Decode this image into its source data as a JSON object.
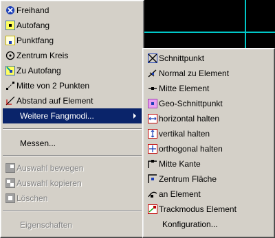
{
  "colors": {
    "menu_bg": "#d4d0c8",
    "highlight": "#0a246a",
    "disabled_text": "#808080",
    "canvas_bg": "#000000",
    "canvas_line": "#00c8c8"
  },
  "main_menu": {
    "items": [
      {
        "label": "Freihand",
        "icon": "freehand-icon"
      },
      {
        "label": "Autofang",
        "icon": "autosnap-icon"
      },
      {
        "label": "Punktfang",
        "icon": "point-snap-icon"
      },
      {
        "label": "Zentrum Kreis",
        "icon": "circle-center-icon"
      },
      {
        "label": "Zu Autofang",
        "icon": "to-autosnap-icon"
      },
      {
        "label": "Mitte von 2 Punkten",
        "icon": "midpoint-two-points-icon"
      },
      {
        "label": "Abstand auf Element",
        "icon": "distance-on-element-icon"
      },
      {
        "label": "Weitere Fangmodi...",
        "highlighted": true,
        "has_submenu": true
      },
      {
        "label": "Messen..."
      },
      {
        "label": "Auswahl bewegen",
        "icon": "move-selection-icon",
        "disabled": true
      },
      {
        "label": "Auswahl kopieren",
        "icon": "copy-selection-icon",
        "disabled": true
      },
      {
        "label": "Löschen",
        "icon": "delete-icon",
        "disabled": true
      },
      {
        "label": "Eigenschaften",
        "disabled": true
      }
    ]
  },
  "sub_menu": {
    "items": [
      {
        "label": "Schnittpunkt",
        "icon": "intersection-icon"
      },
      {
        "label": "Normal zu Element",
        "icon": "perpendicular-icon"
      },
      {
        "label": "Mitte Element",
        "icon": "element-midpoint-icon"
      },
      {
        "label": "Geo-Schnittpunkt",
        "icon": "geo-intersection-icon"
      },
      {
        "label": "horizontal halten",
        "icon": "horizontal-hold-icon"
      },
      {
        "label": "vertikal halten",
        "icon": "vertical-hold-icon"
      },
      {
        "label": "orthogonal halten",
        "icon": "orthogonal-hold-icon"
      },
      {
        "label": "Mitte Kante",
        "icon": "edge-midpoint-icon"
      },
      {
        "label": "Zentrum Fläche",
        "icon": "face-center-icon"
      },
      {
        "label": "an Element",
        "icon": "on-element-icon"
      },
      {
        "label": "Trackmodus Element",
        "icon": "track-mode-icon"
      },
      {
        "label": "Konfiguration..."
      }
    ]
  }
}
